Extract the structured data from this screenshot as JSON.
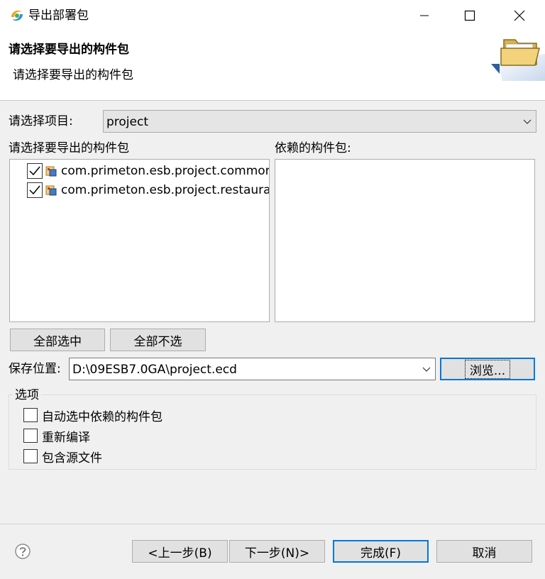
{
  "window": {
    "title": "导出部署包"
  },
  "header": {
    "title": "请选择要导出的构件包",
    "description": "请选择要导出的构件包"
  },
  "project": {
    "label": "请选择项目:",
    "value": "project"
  },
  "packages": {
    "label": "请选择要导出的构件包",
    "items": [
      {
        "text": "com.primeton.esb.project.common",
        "checked": true
      },
      {
        "text": "com.primeton.esb.project.restaurant",
        "checked": true
      }
    ]
  },
  "dependencies": {
    "label": "依赖的构件包:"
  },
  "buttons": {
    "select_all": "全部选中",
    "deselect_all": "全部不选",
    "browse": "浏览...",
    "back": "<上一步(B)",
    "next": "下一步(N)>",
    "finish": "完成(F)",
    "cancel": "取消"
  },
  "save": {
    "label": "保存位置:",
    "value": "D:\\09ESB7.0GA\\project.ecd"
  },
  "options": {
    "group_label": "选项",
    "items": [
      {
        "text": "自动选中依赖的构件包",
        "checked": false
      },
      {
        "text": "重新编译",
        "checked": false
      },
      {
        "text": "包含源文件",
        "checked": false
      }
    ]
  },
  "colors": {
    "focus_border": "#0078d7",
    "window_bg": "#f0f0f0",
    "header_bg": "#ffffff"
  },
  "icons": [
    "app-swirl-icon",
    "minimize-icon",
    "maximize-icon",
    "close-icon",
    "folder-icon",
    "checkmark-icon",
    "package-icon",
    "chevron-down-icon",
    "help-icon"
  ]
}
